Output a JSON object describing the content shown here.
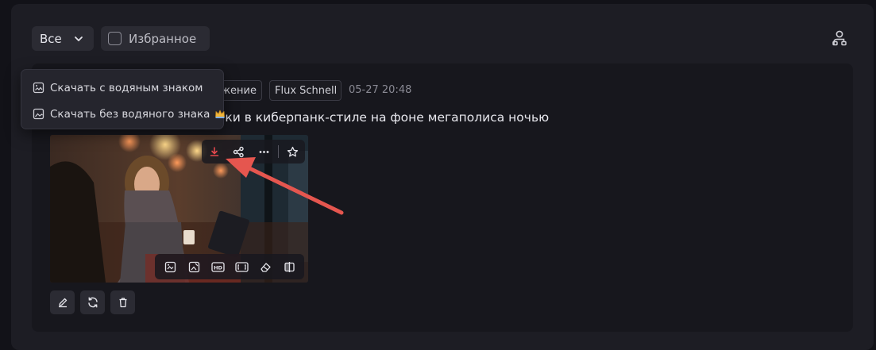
{
  "toolbar": {
    "filter_value": "Все",
    "favorite_label": "Избранное"
  },
  "record": {
    "type_tag": "жение",
    "model_tag": "Flux Schnell",
    "timestamp": "05-27 20:48",
    "prompt": "ушки в киберпанк-стиле на фоне мегаполиса ночью"
  },
  "download_menu": {
    "items": [
      {
        "label": "Скачать с водяным знаком",
        "icon": "image-download-icon"
      },
      {
        "label": "Скачать без водяного знака",
        "icon": "image-icon",
        "badge": "crown-icon"
      }
    ]
  },
  "image_toolbar": [
    "download-icon",
    "share-icon",
    "more-icon",
    "star-icon"
  ],
  "image_tools": [
    "variation-icon",
    "restyle-icon",
    "hd-icon",
    "expand-icon",
    "eraser-icon",
    "compare-icon"
  ],
  "card_actions": [
    "edit-icon",
    "regenerate-icon",
    "delete-icon"
  ],
  "colors": {
    "accent_red": "#e5484d",
    "annotation_arrow": "#e5564f",
    "crown": "#f0b53a"
  }
}
